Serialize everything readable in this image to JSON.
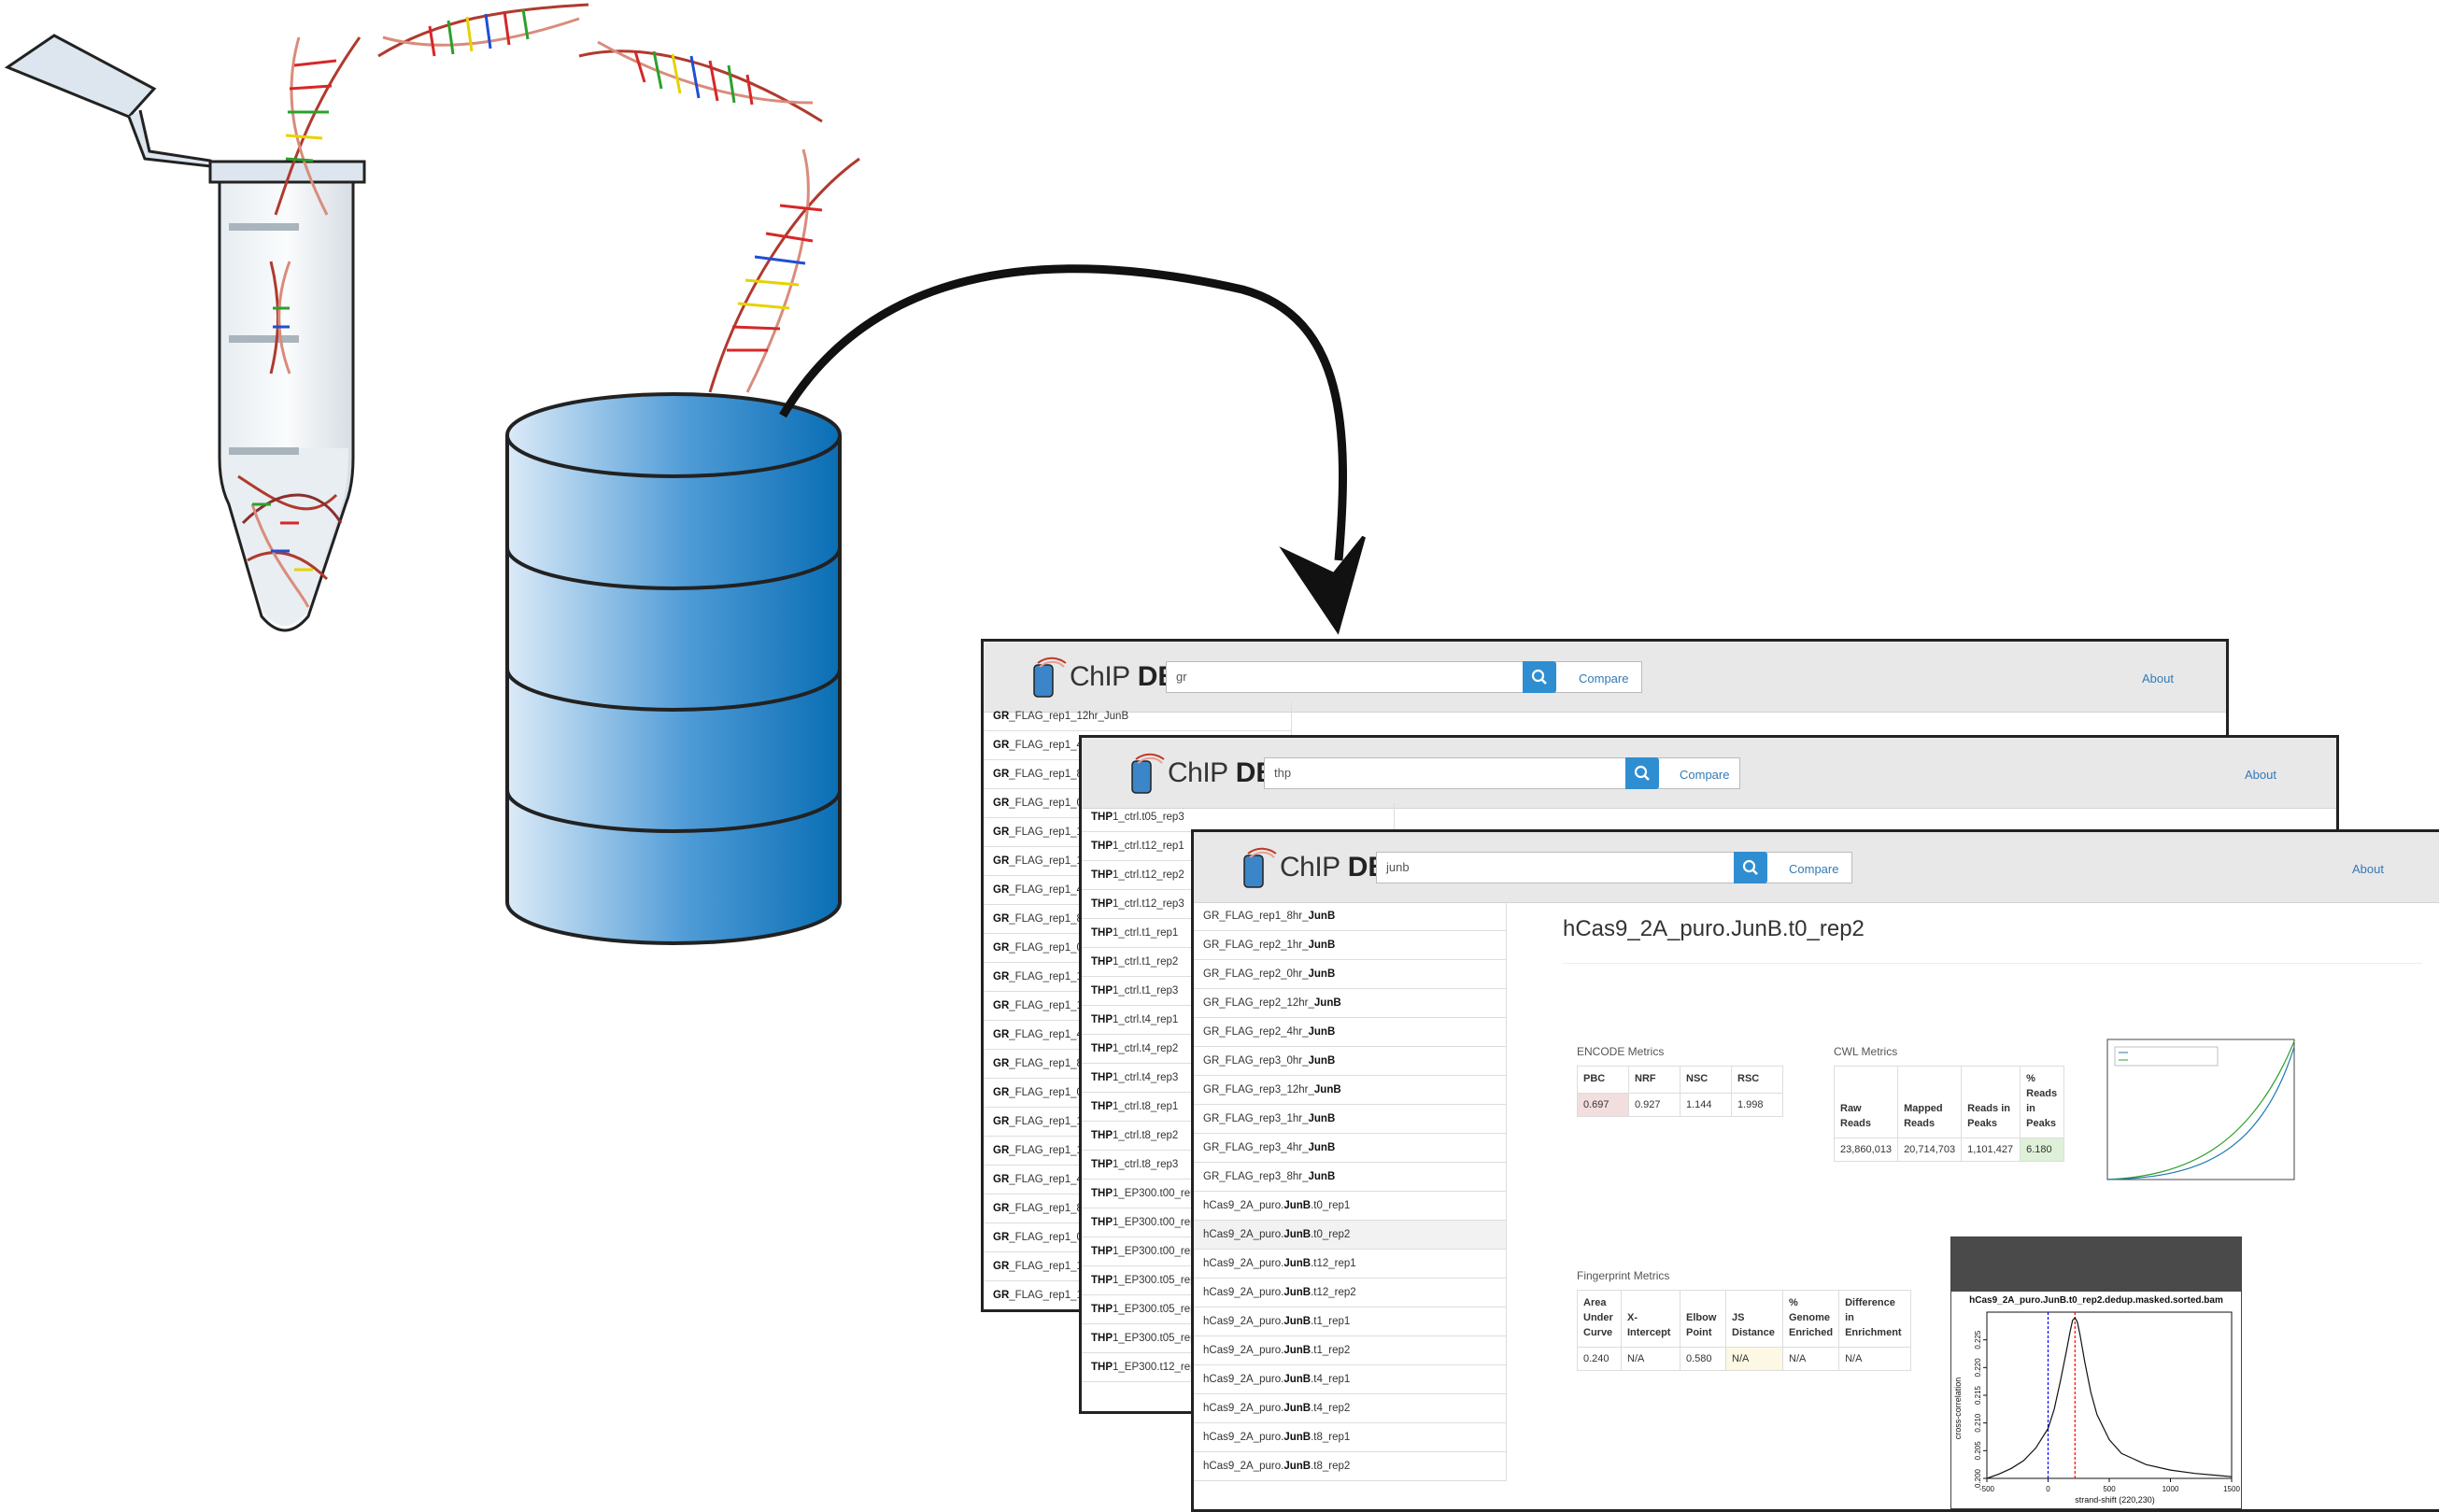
{
  "brand": {
    "chip": "ChIP",
    "db": "DB"
  },
  "colors": {
    "navbar": "#e8e8e8",
    "search_button": "#2f8ed1",
    "link": "#337ab7",
    "db_blue": "#0a6eb4",
    "pbc_bad": "#f2dede",
    "frip_good": "#dff0d8",
    "js_warn": "#fcf8e3"
  },
  "windows": {
    "gr": {
      "search_value": "gr",
      "compare": "Compare",
      "about": "About",
      "list": [
        {
          "bold": "GR",
          "rest": "_FLAG_rep1_12hr_JunB"
        },
        {
          "bold": "GR",
          "rest": "_FLAG_rep1_4hr_JunB"
        },
        {
          "bold": "GR",
          "rest": "_FLAG_rep1_8hr_JunB"
        },
        {
          "bold": "GR",
          "rest": "_FLAG_rep1_0hr_JunB"
        },
        {
          "bold": "GR",
          "rest": "_FLAG_rep1_1hr_JunB"
        },
        {
          "bold": "GR",
          "rest": "_FLAG_rep1_12hr_JunB"
        },
        {
          "bold": "GR",
          "rest": "_FLAG_rep1_4hr_JunB"
        },
        {
          "bold": "GR",
          "rest": "_FLAG_rep1_8hr_JunB"
        },
        {
          "bold": "GR",
          "rest": "_FLAG_rep1_0hr_JunB"
        },
        {
          "bold": "GR",
          "rest": "_FLAG_rep1_1hr_JunB"
        },
        {
          "bold": "GR",
          "rest": "_FLAG_rep1_12hr_JunB"
        },
        {
          "bold": "GR",
          "rest": "_FLAG_rep1_4hr_JunB"
        },
        {
          "bold": "GR",
          "rest": "_FLAG_rep1_8hr_JunB"
        },
        {
          "bold": "GR",
          "rest": "_FLAG_rep1_0hr_JunB"
        },
        {
          "bold": "GR",
          "rest": "_FLAG_rep1_1hr_JunB"
        },
        {
          "bold": "GR",
          "rest": "_FLAG_rep1_12hr_JunB"
        },
        {
          "bold": "GR",
          "rest": "_FLAG_rep1_4hr_JunB"
        },
        {
          "bold": "GR",
          "rest": "_FLAG_rep1_8hr_JunB"
        },
        {
          "bold": "GR",
          "rest": "_FLAG_rep1_0hr_JunB"
        },
        {
          "bold": "GR",
          "rest": "_FLAG_rep1_1hr_JunB"
        },
        {
          "bold": "GR",
          "rest": "_FLAG_rep1_12hr_JunB"
        }
      ]
    },
    "thp": {
      "search_value": "thp",
      "compare": "Compare",
      "about": "About",
      "list": [
        {
          "bold": "THP",
          "rest": "1_ctrl.t05_rep3"
        },
        {
          "bold": "THP",
          "rest": "1_ctrl.t12_rep1"
        },
        {
          "bold": "THP",
          "rest": "1_ctrl.t12_rep2"
        },
        {
          "bold": "THP",
          "rest": "1_ctrl.t12_rep3"
        },
        {
          "bold": "THP",
          "rest": "1_ctrl.t1_rep1"
        },
        {
          "bold": "THP",
          "rest": "1_ctrl.t1_rep2"
        },
        {
          "bold": "THP",
          "rest": "1_ctrl.t1_rep3"
        },
        {
          "bold": "THP",
          "rest": "1_ctrl.t4_rep1"
        },
        {
          "bold": "THP",
          "rest": "1_ctrl.t4_rep2"
        },
        {
          "bold": "THP",
          "rest": "1_ctrl.t4_rep3"
        },
        {
          "bold": "THP",
          "rest": "1_ctrl.t8_rep1"
        },
        {
          "bold": "THP",
          "rest": "1_ctrl.t8_rep2"
        },
        {
          "bold": "THP",
          "rest": "1_ctrl.t8_rep3"
        },
        {
          "bold": "THP",
          "rest": "1_EP300.t00_rep1"
        },
        {
          "bold": "THP",
          "rest": "1_EP300.t00_rep2"
        },
        {
          "bold": "THP",
          "rest": "1_EP300.t00_rep3"
        },
        {
          "bold": "THP",
          "rest": "1_EP300.t05_rep1"
        },
        {
          "bold": "THP",
          "rest": "1_EP300.t05_rep2"
        },
        {
          "bold": "THP",
          "rest": "1_EP300.t05_rep3"
        },
        {
          "bold": "THP",
          "rest": "1_EP300.t12_rep1"
        }
      ]
    },
    "junb": {
      "search_value": "junb",
      "compare": "Compare",
      "about": "About",
      "list": [
        {
          "pre": "GR_FLAG_rep1_8hr_",
          "bold": "JunB",
          "post": ""
        },
        {
          "pre": "GR_FLAG_rep2_1hr_",
          "bold": "JunB",
          "post": ""
        },
        {
          "pre": "GR_FLAG_rep2_0hr_",
          "bold": "JunB",
          "post": ""
        },
        {
          "pre": "GR_FLAG_rep2_12hr_",
          "bold": "JunB",
          "post": ""
        },
        {
          "pre": "GR_FLAG_rep2_4hr_",
          "bold": "JunB",
          "post": ""
        },
        {
          "pre": "GR_FLAG_rep3_0hr_",
          "bold": "JunB",
          "post": ""
        },
        {
          "pre": "GR_FLAG_rep3_12hr_",
          "bold": "JunB",
          "post": ""
        },
        {
          "pre": "GR_FLAG_rep3_1hr_",
          "bold": "JunB",
          "post": ""
        },
        {
          "pre": "GR_FLAG_rep3_4hr_",
          "bold": "JunB",
          "post": ""
        },
        {
          "pre": "GR_FLAG_rep3_8hr_",
          "bold": "JunB",
          "post": ""
        },
        {
          "pre": "hCas9_2A_puro.",
          "bold": "JunB",
          "post": ".t0_rep1"
        },
        {
          "pre": "hCas9_2A_puro.",
          "bold": "JunB",
          "post": ".t0_rep2"
        },
        {
          "pre": "hCas9_2A_puro.",
          "bold": "JunB",
          "post": ".t12_rep1"
        },
        {
          "pre": "hCas9_2A_puro.",
          "bold": "JunB",
          "post": ".t12_rep2"
        },
        {
          "pre": "hCas9_2A_puro.",
          "bold": "JunB",
          "post": ".t1_rep1"
        },
        {
          "pre": "hCas9_2A_puro.",
          "bold": "JunB",
          "post": ".t1_rep2"
        },
        {
          "pre": "hCas9_2A_puro.",
          "bold": "JunB",
          "post": ".t4_rep1"
        },
        {
          "pre": "hCas9_2A_puro.",
          "bold": "JunB",
          "post": ".t4_rep2"
        },
        {
          "pre": "hCas9_2A_puro.",
          "bold": "JunB",
          "post": ".t8_rep1"
        },
        {
          "pre": "hCas9_2A_puro.",
          "bold": "JunB",
          "post": ".t8_rep2"
        }
      ],
      "selected_index": 11,
      "detail": {
        "title": "hCas9_2A_puro.JunB.t0_rep2",
        "encode_label": "ENCODE Metrics",
        "encode_headers": [
          "PBC",
          "NRF",
          "NSC",
          "RSC"
        ],
        "encode_values": [
          "0.697",
          "0.927",
          "1.144",
          "1.998"
        ],
        "cwl_label": "CWL Metrics",
        "cwl_headers": [
          "Raw Reads",
          "Mapped Reads",
          "Reads in Peaks",
          "% Reads in Peaks"
        ],
        "cwl_values": [
          "23,860,013",
          "20,714,703",
          "1,101,427",
          "6.180"
        ],
        "fingerprint_label": "Fingerprint Metrics",
        "fp_headers": [
          "Area Under Curve",
          "X-Intercept",
          "Elbow Point",
          "JS Distance",
          "% Genome Enriched",
          "Difference in Enrichment"
        ],
        "fp_values": [
          "0.240",
          "N/A",
          "0.580",
          "N/A",
          "N/A",
          "N/A"
        ],
        "xcor_title": "hCas9_2A_puro.JunB.t0_rep2.dedup.masked.sorted.bam",
        "xcor_xlabel": "strand-shift (220,230)",
        "xcor_ylabel": "cross-correlation"
      }
    }
  },
  "chart_data": {
    "type": "line",
    "title": "hCas9_2A_puro.JunB.t0_rep2.dedup.masked.sorted.bam",
    "xlabel": "strand-shift (220,230)",
    "ylabel": "cross-correlation",
    "xlim": [
      -500,
      1500
    ],
    "ylim": [
      0.2,
      0.23
    ],
    "x_ticks": [
      "-500",
      "0",
      "500",
      "1000",
      "1500"
    ],
    "y_ticks": [
      "0.200",
      "0.205",
      "0.210",
      "0.215",
      "0.220",
      "0.225"
    ],
    "x": [
      -500,
      -400,
      -300,
      -200,
      -100,
      0,
      50,
      100,
      150,
      180,
      200,
      220,
      240,
      260,
      300,
      350,
      400,
      500,
      600,
      800,
      1000,
      1200,
      1400,
      1500
    ],
    "values": [
      0.2,
      0.2008,
      0.2018,
      0.2032,
      0.2055,
      0.209,
      0.2125,
      0.2175,
      0.223,
      0.2265,
      0.2285,
      0.229,
      0.2282,
      0.226,
      0.221,
      0.2155,
      0.2115,
      0.207,
      0.2045,
      0.2025,
      0.2015,
      0.2009,
      0.2005,
      0.2003
    ],
    "vlines": [
      {
        "x": 0,
        "color": "blue"
      },
      {
        "x": 220,
        "color": "red"
      }
    ],
    "grid": false
  }
}
